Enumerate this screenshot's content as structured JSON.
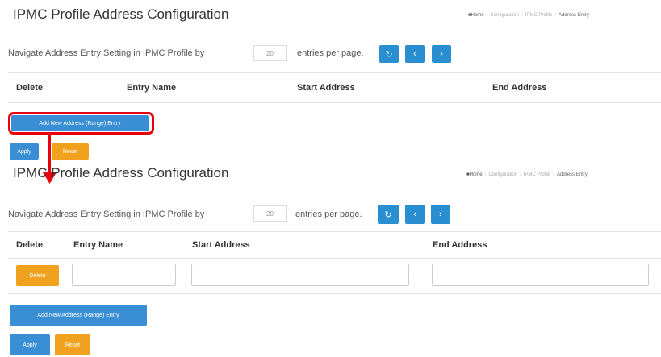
{
  "panel1": {
    "title": "IPMC Profile Address Configuration",
    "breadcrumb": [
      "Home",
      "Configuration",
      "IPMC Profile",
      "Address Entry"
    ],
    "nav_text_pre": "Navigate Address Entry Setting in IPMC Profile by",
    "entries_value": "20",
    "nav_text_post": "entries per page.",
    "headers": [
      "Delete",
      "Entry Name",
      "Start Address",
      "End Address"
    ],
    "add_label": "Add New Address (Range) Entry",
    "apply_label": "Apply",
    "reset_label": "Reset"
  },
  "panel2": {
    "title": "IPMC Profile Address Configuration",
    "breadcrumb": [
      "Home",
      "Configuration",
      "IPMC Profile",
      "Address Entry"
    ],
    "nav_text_pre": "Navigate Address Entry Setting in IPMC Profile by",
    "entries_value": "20",
    "nav_text_post": "entries per page.",
    "headers": [
      "Delete",
      "Entry Name",
      "Start Address",
      "End Address"
    ],
    "row": {
      "delete_label": "Delete",
      "entry_name": "",
      "start_address": "",
      "end_address": ""
    },
    "add_label": "Add New Address (Range) Entry",
    "apply_label": "Apply",
    "reset_label": "Reset"
  },
  "icons": {
    "refresh": "refresh-icon",
    "prev": "chevron-left-icon",
    "next": "chevron-right-icon",
    "home": "home-icon"
  },
  "colors": {
    "primary": "#2a8fd0",
    "warning": "#f0a21f",
    "highlight": "#e8000b"
  }
}
